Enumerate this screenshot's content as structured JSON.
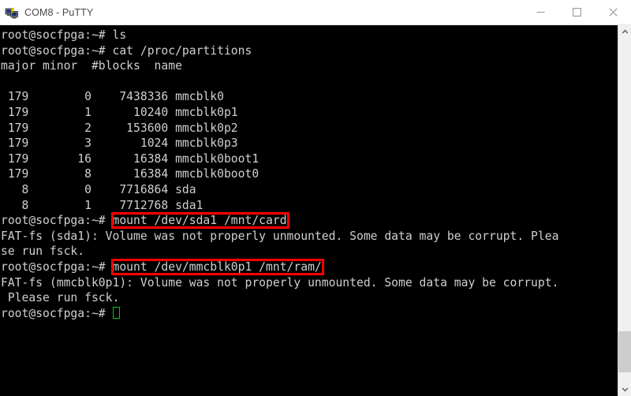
{
  "window": {
    "title": "COM8 - PuTTY",
    "icon": "putty-icon",
    "controls": {
      "minimize": "minimize-icon",
      "maximize": "maximize-icon",
      "close": "close-icon"
    }
  },
  "terminal": {
    "prompt": "root@socfpga:~#",
    "foreground_color": "#cfcfcf",
    "background_color": "#000000",
    "cursor_color": "#00cc00",
    "annotation_color": "#ff0000",
    "lines": [
      "root@socfpga:~# ls",
      "root@socfpga:~# cat /proc/partitions",
      "major minor  #blocks  name",
      "",
      " 179        0    7438336 mmcblk0",
      " 179        1      10240 mmcblk0p1",
      " 179        2     153600 mmcblk0p2",
      " 179        3       1024 mmcblk0p3",
      " 179       16      16384 mmcblk0boot1",
      " 179        8      16384 mmcblk0boot0",
      "   8        0    7716864 sda",
      "   8        1    7712768 sda1",
      "root@socfpga:~# mount /dev/sda1 /mnt/card",
      "FAT-fs (sda1): Volume was not properly unmounted. Some data may be corrupt. Plea",
      "se run fsck.",
      "root@socfpga:~# mount /dev/mmcblk0p1 /mnt/ram/",
      "FAT-fs (mmcblk0p1): Volume was not properly unmounted. Some data may be corrupt.",
      " Please run fsck.",
      "root@socfpga:~# "
    ],
    "highlighted_commands": [
      "mount /dev/sda1 /mnt/card",
      "mount /dev/mmcblk0p1 /mnt/ram/"
    ]
  },
  "scrollbar": {
    "up_arrow": "chevron-up-icon",
    "down_arrow": "chevron-down-icon"
  }
}
